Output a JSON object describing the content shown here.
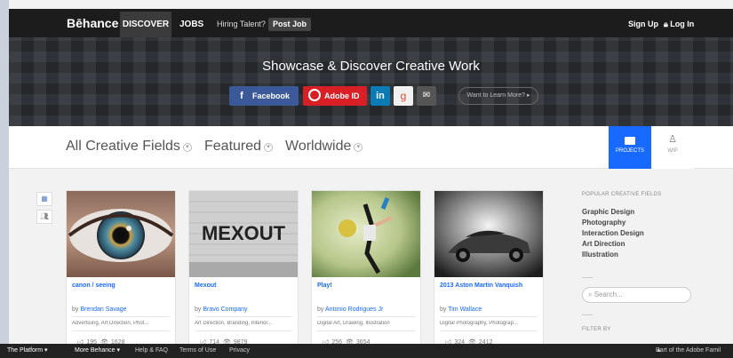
{
  "nav": {
    "logo": "Bēhance",
    "discover": "DISCOVER",
    "jobs": "JOBS",
    "hiring": "Hiring Talent?",
    "post_job": "Post Job",
    "sign_up": "Sign Up",
    "log_in": "Log In"
  },
  "hero": {
    "title": "Showcase & Discover Creative Work",
    "facebook": "Facebook",
    "adobe_id": "Adobe ID",
    "linkedin": "in",
    "googleplus": "g",
    "learn_more": "Want to Learn More? ▸"
  },
  "filters": {
    "fields": "All Creative Fields",
    "featured": "Featured",
    "worldwide": "Worldwide",
    "projects_tab": "PROJECTS",
    "wip_tab": "WIP"
  },
  "cards": [
    {
      "title": "canon / seeing",
      "by": "by",
      "author": "Brendan Savage",
      "tags": "Advertising, Art Direction, Phot...",
      "appreciations": "195",
      "views": "1628"
    },
    {
      "title": "Mexout",
      "by": "by",
      "author": "Bravo Company",
      "tags": "Art Direction, Branding, Interior...",
      "appreciations": "714",
      "views": "9879"
    },
    {
      "title": "Play!",
      "by": "by",
      "author": "Antonio Rodrigues Jr",
      "tags": "Digital Art, Drawing, Illustration",
      "appreciations": "256",
      "views": "3654"
    },
    {
      "title": "2013 Aston Martin Vanquish",
      "by": "by",
      "author": "Tim Wallace",
      "tags": "Digital Photography, Photograp...",
      "appreciations": "324",
      "views": "2412"
    }
  ],
  "sidebar": {
    "popular_heading": "POPULAR CREATIVE FIELDS",
    "fields": [
      "Graphic Design",
      "Photography",
      "Interaction Design",
      "Art Direction",
      "Illustration"
    ],
    "search_placeholder": "Search...",
    "filter_by": "FILTER BY"
  },
  "footer": {
    "platform": "The Platform ▾",
    "more": "More Behance ▾",
    "help": "Help & FAQ",
    "terms": "Terms of Use",
    "privacy": "Privacy",
    "adobe": "Part of the Adobe Famil"
  },
  "colors": {
    "accent": "#1769ff",
    "nav_bg": "#1c1c1c",
    "facebook": "#3b5998",
    "adobe": "#d81f26",
    "linkedin": "#0a7bb5"
  }
}
